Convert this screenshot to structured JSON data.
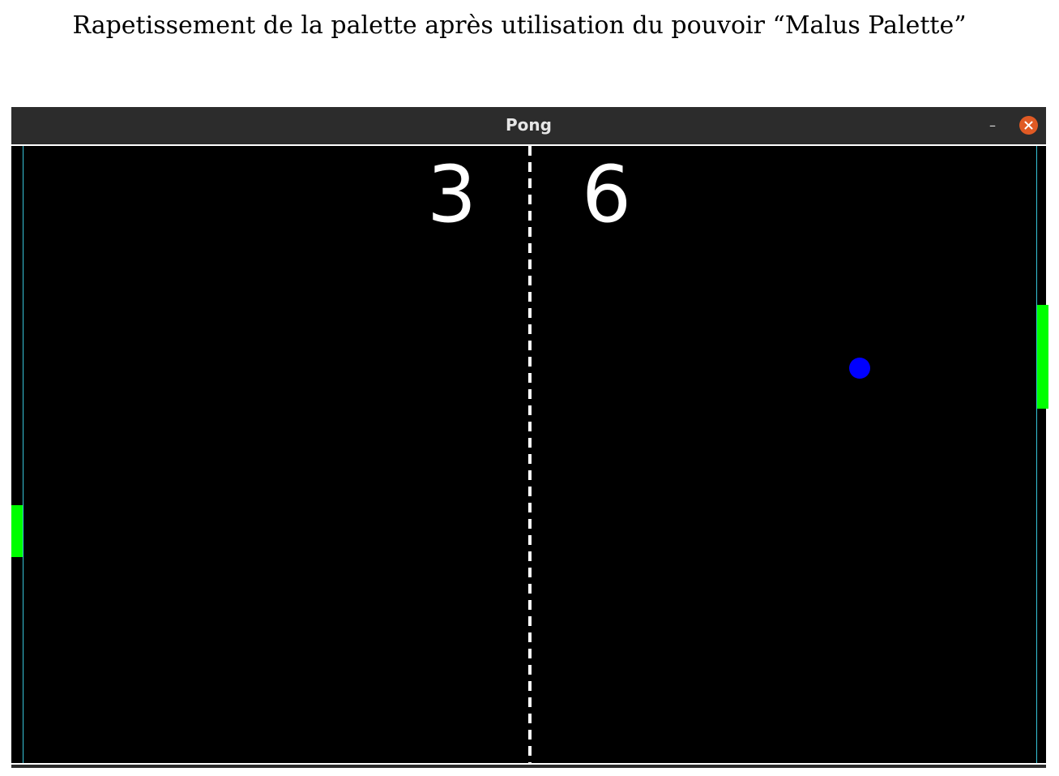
{
  "caption": "Rapetissement de la palette après utilisation du pouvoir “Malus Palette”",
  "window": {
    "title": "Pong",
    "minimize_label": "–",
    "close_icon": "close-icon"
  },
  "game": {
    "score_left": "3",
    "score_right": "6",
    "colors": {
      "background": "#000000",
      "paddle": "#00ff00",
      "ball": "#0000ff",
      "goal_line": "#36c3d8",
      "center_line": "#ffffff",
      "close_button": "#e05a24"
    }
  }
}
